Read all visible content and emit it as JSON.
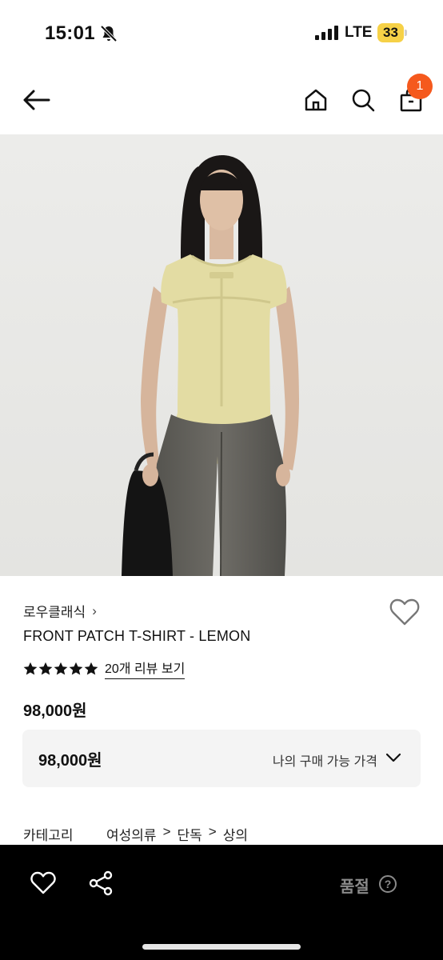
{
  "status": {
    "time": "15:01",
    "network": "LTE",
    "battery": "33"
  },
  "header": {
    "cart_count": "1",
    "icons": [
      "back-arrow-icon",
      "home-icon",
      "search-icon",
      "shopping-bag-icon"
    ]
  },
  "product": {
    "image_desc": "model-wearing-lemon-tshirt",
    "brand": "로우클래식",
    "title": "FRONT PATCH T-SHIRT - LEMON",
    "rating": 5,
    "review_link": "20개 리뷰 보기",
    "price": "98,000원"
  },
  "price_box": {
    "price": "98,000원",
    "label": "나의 구매 가능 가격"
  },
  "category": {
    "label": "카테고리",
    "path": [
      "여성의류",
      "단독",
      "상의"
    ]
  },
  "bottom_bar": {
    "status": "품절",
    "help": "?"
  },
  "colors": {
    "accent": "#f5591d",
    "shirt": "#e3dca3",
    "bottom_bar": "#000000"
  }
}
